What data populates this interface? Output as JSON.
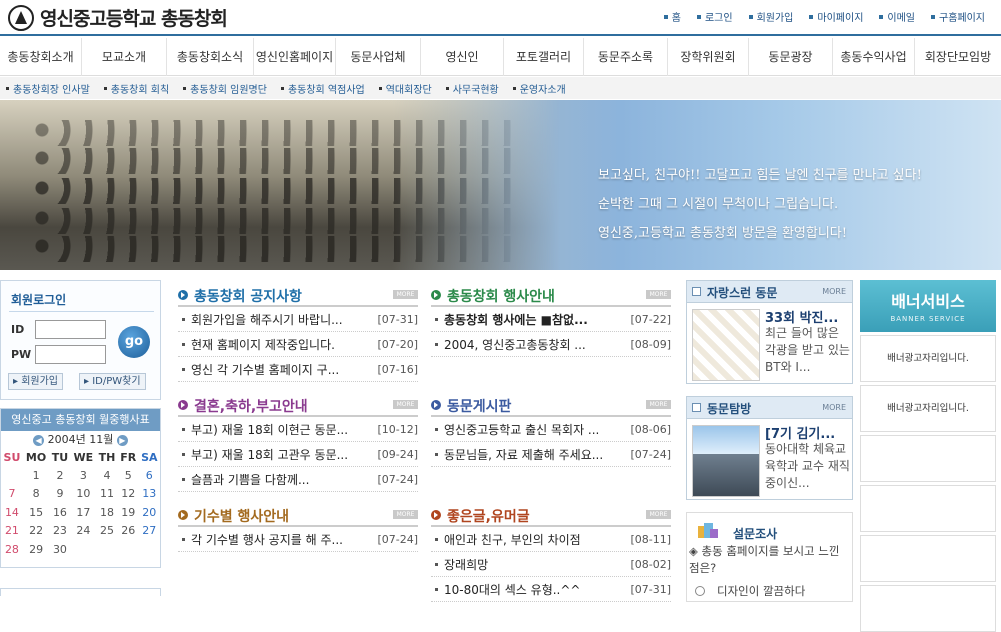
{
  "header": {
    "title": "영신중고등학교 총동창회",
    "util": [
      "홈",
      "로그인",
      "회원가입",
      "마이페이지",
      "이메일",
      "구홈페이지"
    ]
  },
  "gnb": [
    "총동창회소개",
    "모교소개",
    "총동창회소식",
    "영신인홈페이지",
    "동문사업체",
    "영신인",
    "포토갤러리",
    "동문주소록",
    "장학위원회",
    "동문광장",
    "총동수익사업",
    "회장단모임방"
  ],
  "snb": [
    "총동창회장 인사말",
    "총동창회 회칙",
    "총동창회 임원명단",
    "총동창회 역점사업",
    "역대회장단",
    "사무국현황",
    "운영자소개"
  ],
  "hero": {
    "lines": [
      "보고싶다, 친구야!! 고달프고 힘든 날엔 친구를 만나고 싶다!",
      "순박한 그때 그 시절이 무척이나 그립습니다.",
      "영신중,고등학교 총동창회 방문을 환영합니다!"
    ]
  },
  "login": {
    "title": "회원로그인",
    "id_label": "ID",
    "pw_label": "PW",
    "go": "go",
    "join": "회원가입",
    "find": "ID/PW찾기"
  },
  "calendar": {
    "title": "영신중고 총동창회 월중행사표",
    "month": "2004년 11월",
    "days": [
      "SU",
      "MO",
      "TU",
      "WE",
      "TH",
      "FR",
      "SA"
    ],
    "weeks": [
      [
        "",
        "1",
        "2",
        "3",
        "4",
        "5",
        "6"
      ],
      [
        "7",
        "8",
        "9",
        "10",
        "11",
        "12",
        "13"
      ],
      [
        "14",
        "15",
        "16",
        "17",
        "18",
        "19",
        "20"
      ],
      [
        "21",
        "22",
        "23",
        "24",
        "25",
        "26",
        "27"
      ],
      [
        "28",
        "29",
        "30",
        "",
        "",
        "",
        ""
      ]
    ]
  },
  "more_label": "MORE",
  "boards": [
    {
      "title": "총동창회 공지사항",
      "color": "#1f6fa8",
      "items": [
        {
          "t": "회원가입을 해주시기 바랍니...",
          "d": "[07-31]"
        },
        {
          "t": "현재 홈페이지 제작중입니다.",
          "d": "[07-20]"
        },
        {
          "t": "영신 각 기수별 홈페이지 구...",
          "d": "[07-16]"
        }
      ]
    },
    {
      "title": "총동창회 행사안내",
      "color": "#2b8a4a",
      "items": [
        {
          "t": "총동창회 행사에는 ■참없...",
          "d": "[07-22]",
          "bold": true
        },
        {
          "t": "2004, 영신중고총동창회 ...",
          "d": "[08-09]"
        }
      ]
    },
    {
      "title": "결혼,축하,부고안내",
      "color": "#8a3a8f",
      "items": [
        {
          "t": "부고) 재울 18회 이현근 동문...",
          "d": "[10-12]"
        },
        {
          "t": "부고) 재울 18회 고관우 동문...",
          "d": "[09-24]"
        },
        {
          "t": "슬픔과 기쁨을 다함께...",
          "d": "[07-24]"
        }
      ]
    },
    {
      "title": "동문게시판",
      "color": "#3b5aa0",
      "items": [
        {
          "t": "영신중고등학교 출신 목회자 ...",
          "d": "[08-06]"
        },
        {
          "t": "동문님들, 자료 제출해 주세요...",
          "d": "[07-24]"
        }
      ]
    },
    {
      "title": "기수별 행사안내",
      "color": "#a36a1f",
      "items": [
        {
          "t": "각 기수별 행사 공지를 해 주...",
          "d": "[07-24]"
        }
      ]
    },
    {
      "title": "좋은글,유머글",
      "color": "#b0451f",
      "items": [
        {
          "t": "애인과 친구, 부인의 차이점",
          "d": "[08-11]"
        },
        {
          "t": "장래희망",
          "d": "[08-02]"
        },
        {
          "t": "10-80대의 섹스 유형..^^",
          "d": "[07-31]"
        }
      ]
    }
  ],
  "side": [
    {
      "title": "자랑스런 동문",
      "more": "MORE",
      "headline": "33회 박진...",
      "desc": "최근 들어 많은 각광을 받고 있는 BT와 I..."
    },
    {
      "title": "동문탐방",
      "more": "MORE",
      "headline": "[7기 김기...",
      "desc": "동아대학 체육교육학과 교수 재직중이신..."
    }
  ],
  "poll": {
    "title": "설문조사",
    "question": "◈ 총동 홈페이지를 보시고 느낀 점은?",
    "option": "디자인이 깔끔하다"
  },
  "banner": {
    "title": "배너서비스",
    "sub": "BANNER SERVICE",
    "slots": [
      "배너광고자리입니다.",
      "배너광고자리입니다.",
      "",
      "",
      "",
      ""
    ]
  }
}
